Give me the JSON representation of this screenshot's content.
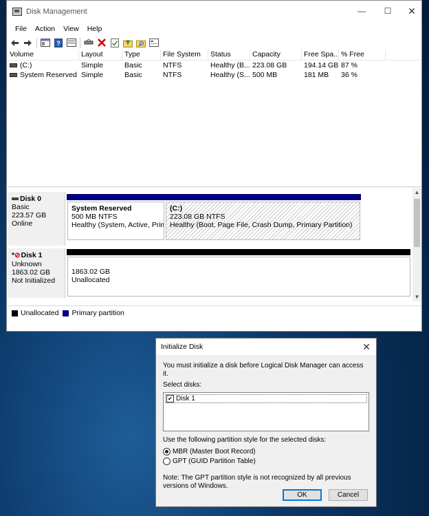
{
  "window": {
    "title": "Disk Management",
    "min": "—",
    "max": "☐",
    "close": "✕"
  },
  "menu": [
    "File",
    "Action",
    "View",
    "Help"
  ],
  "volumes": {
    "headers": [
      "Volume",
      "Layout",
      "Type",
      "File System",
      "Status",
      "Capacity",
      "Free Spa...",
      "% Free"
    ],
    "rows": [
      [
        "(C:)",
        "Simple",
        "Basic",
        "NTFS",
        "Healthy (B...",
        "223.08 GB",
        "194.14 GB",
        "87 %"
      ],
      [
        "System Reserved",
        "Simple",
        "Basic",
        "NTFS",
        "Healthy (S...",
        "500 MB",
        "181 MB",
        "36 %"
      ]
    ]
  },
  "disks": [
    {
      "name": "Disk 0",
      "type": "Basic",
      "size": "223.57 GB",
      "status": "Online",
      "partitions": [
        {
          "name": "System Reserved",
          "size": "500 MB NTFS",
          "status": "Healthy (System, Active, Prima"
        },
        {
          "name": "(C:)",
          "size": "223.08 GB NTFS",
          "status": "Healthy (Boot, Page File, Crash Dump, Primary Partition)"
        }
      ]
    },
    {
      "name": "Disk 1",
      "marker": "*",
      "type": "Unknown",
      "size": "1863.02 GB",
      "status": "Not Initialized",
      "partitions": [
        {
          "size": "1863.02 GB",
          "status": "Unallocated"
        }
      ]
    }
  ],
  "legend": {
    "unallocated": "Unallocated",
    "primary": "Primary partition"
  },
  "colors": {
    "unallocated": "#000000",
    "primary": "#00007c",
    "accent": "#0078d7"
  },
  "dialog": {
    "title": "Initialize Disk",
    "intro": "You must initialize a disk before Logical Disk Manager can access it.",
    "select_label": "Select disks:",
    "disk_item": "Disk 1",
    "style_label": "Use the following partition style for the selected disks:",
    "mbr": "MBR (Master Boot Record)",
    "gpt": "GPT (GUID Partition Table)",
    "note": "Note: The GPT partition style is not recognized by all previous versions of Windows.",
    "ok": "OK",
    "cancel": "Cancel"
  }
}
